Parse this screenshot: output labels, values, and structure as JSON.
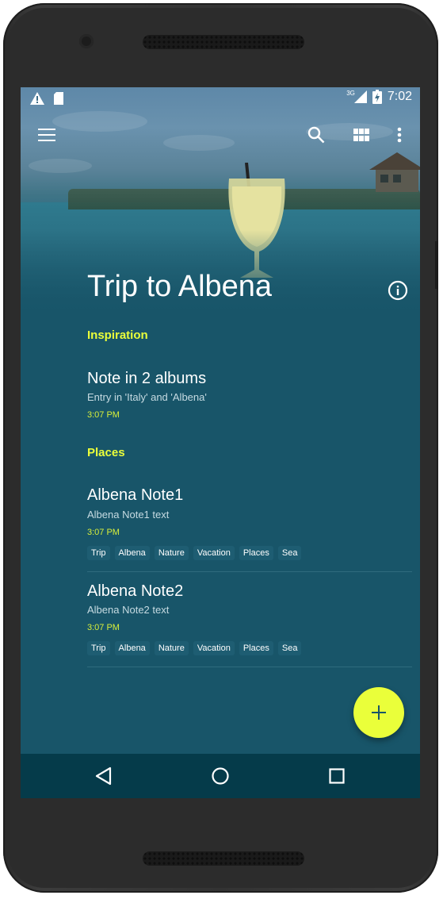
{
  "status_bar": {
    "time": "7:02",
    "network": "3G",
    "icons": [
      "warning-icon",
      "sd-card-icon",
      "signal-icon",
      "battery-icon"
    ]
  },
  "toolbar": {
    "icons": [
      "menu-icon",
      "search-icon",
      "grid-icon",
      "more-vert-icon"
    ]
  },
  "album": {
    "title": "Trip to Albena",
    "info_icon": "info-icon"
  },
  "sections": [
    {
      "label": "Inspiration",
      "entries": [
        {
          "title": "Note in 2 albums",
          "subtitle": "Entry in 'Italy' and 'Albena'",
          "time": "3:07 PM",
          "tags": []
        }
      ]
    },
    {
      "label": "Places",
      "entries": [
        {
          "title": "Albena Note1",
          "subtitle": "Albena Note1 text",
          "time": "3:07 PM",
          "tags": [
            "Trip",
            "Albena",
            "Nature",
            "Vacation",
            "Places",
            "Sea"
          ]
        },
        {
          "title": "Albena Note2",
          "subtitle": "Albena Note2 text",
          "time": "3:07 PM",
          "tags": [
            "Trip",
            "Albena",
            "Nature",
            "Vacation",
            "Places",
            "Sea"
          ]
        }
      ]
    }
  ],
  "fab": {
    "icon": "plus-icon"
  },
  "nav_bar": {
    "icons": [
      "back-icon",
      "home-icon",
      "recents-icon"
    ]
  },
  "colors": {
    "background": "#185569",
    "accent": "#eaff3a",
    "nav_bar": "#053b4a"
  }
}
